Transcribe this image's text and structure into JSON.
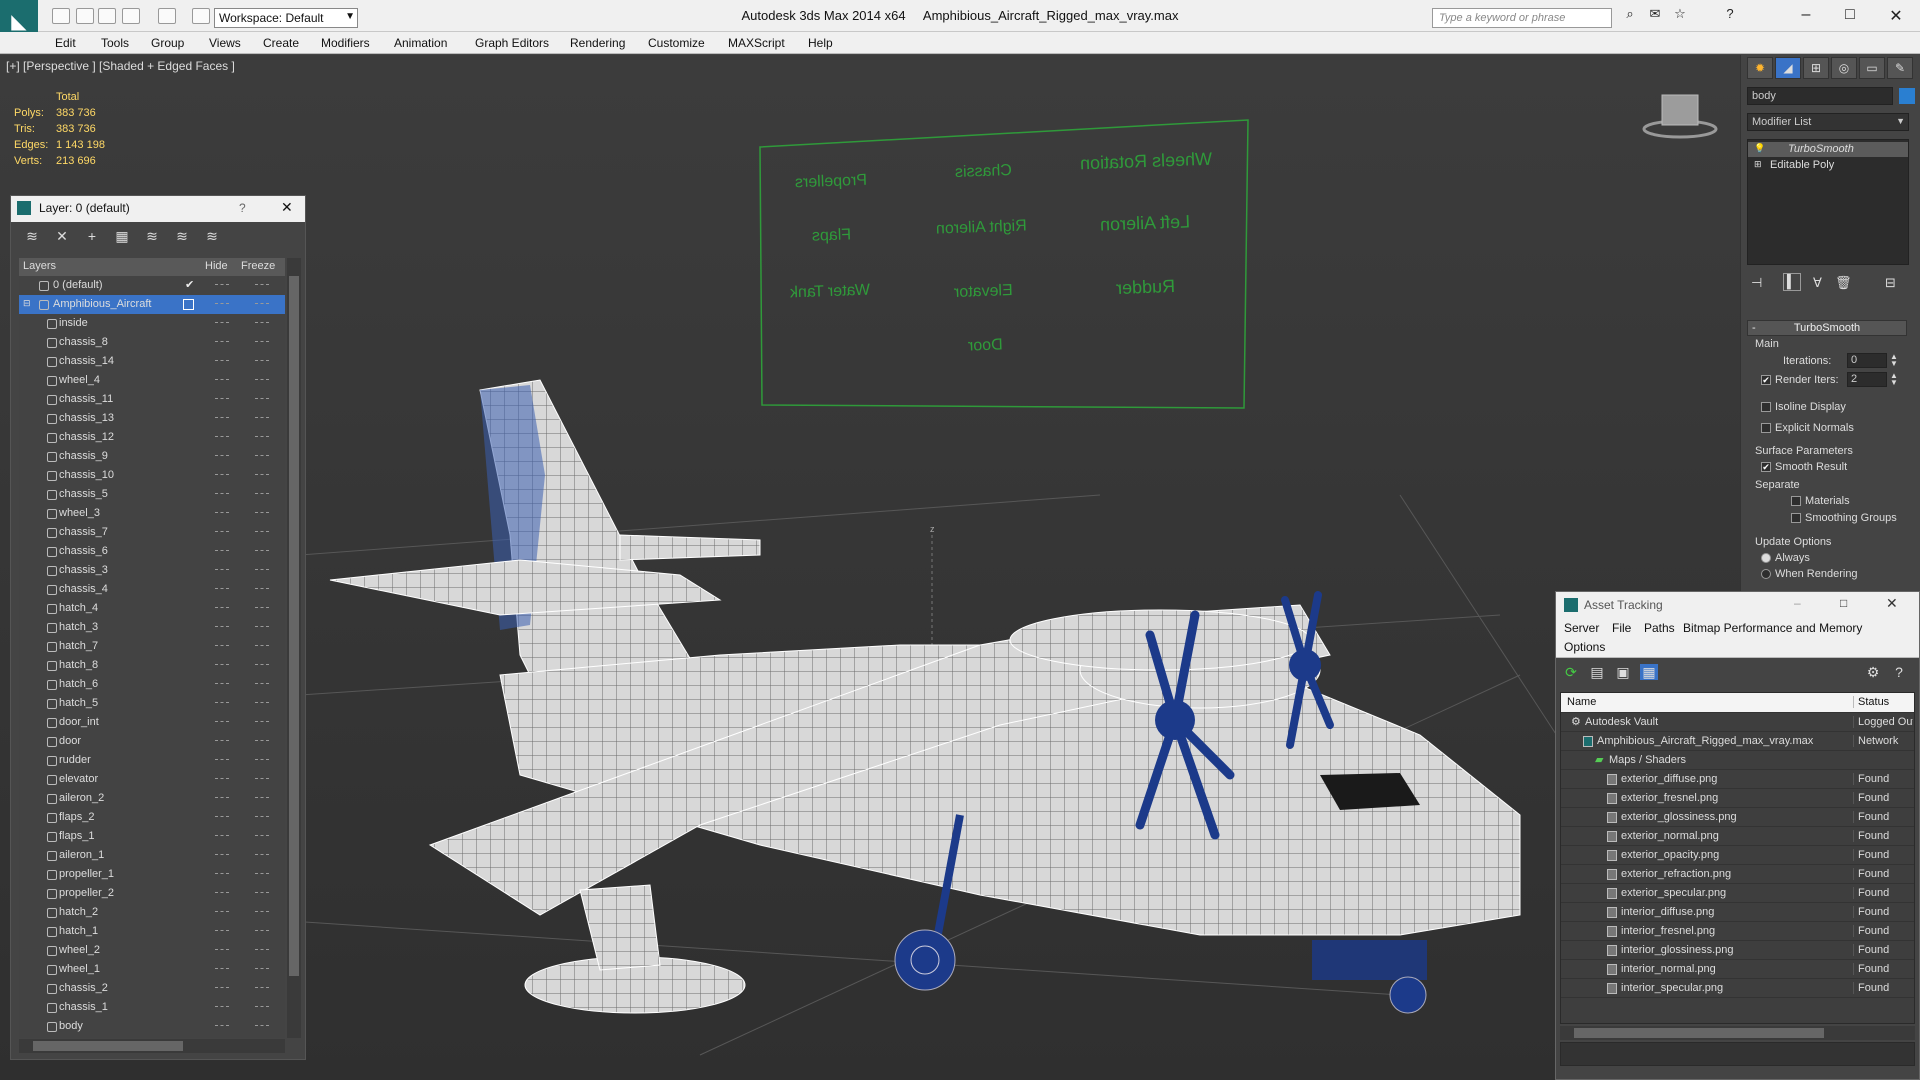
{
  "titlebar": {
    "app": "Autodesk 3ds Max  2014 x64",
    "file": "Amphibious_Aircraft_Rigged_max_vray.max",
    "workspace": "Workspace: Default",
    "search_placeholder": "Type a keyword or phrase"
  },
  "menu": [
    "Edit",
    "Tools",
    "Group",
    "Views",
    "Create",
    "Modifiers",
    "Animation",
    "Graph Editors",
    "Rendering",
    "Customize",
    "MAXScript",
    "Help"
  ],
  "viewport": {
    "label": "[+] [Perspective ] [Shaded + Edged Faces ]",
    "stats": {
      "header": "Total",
      "rows": [
        {
          "label": "Polys:",
          "value": "383 736"
        },
        {
          "label": "Tris:",
          "value": "383 736"
        },
        {
          "label": "Edges:",
          "value": "1 143 198"
        },
        {
          "label": "Verts:",
          "value": "213 696"
        }
      ]
    },
    "rig_panel": {
      "labels": [
        "Propellers",
        "Chassis",
        "Wheels Rotation",
        "Flaps",
        "Right Aileron",
        "Left Aileron",
        "Water Tank",
        "Elevator",
        "Rudder",
        "Door"
      ]
    },
    "axis_label": "z"
  },
  "layers": {
    "title": "Layer: 0 (default)",
    "help": "?",
    "columns": {
      "name": "Layers",
      "hide": "Hide",
      "freeze": "Freeze"
    },
    "root_layers": [
      {
        "name": "0 (default)"
      },
      {
        "name": "Amphibious_Aircraft"
      }
    ],
    "objects": [
      "inside",
      "chassis_8",
      "chassis_14",
      "wheel_4",
      "chassis_11",
      "chassis_13",
      "chassis_12",
      "chassis_9",
      "chassis_10",
      "chassis_5",
      "wheel_3",
      "chassis_7",
      "chassis_6",
      "chassis_3",
      "chassis_4",
      "hatch_4",
      "hatch_3",
      "hatch_7",
      "hatch_8",
      "hatch_6",
      "hatch_5",
      "door_int",
      "door",
      "rudder",
      "elevator",
      "aileron_2",
      "flaps_2",
      "flaps_1",
      "aileron_1",
      "propeller_1",
      "propeller_2",
      "hatch_2",
      "hatch_1",
      "wheel_2",
      "wheel_1",
      "chassis_2",
      "chassis_1",
      "body"
    ]
  },
  "command_panel": {
    "object_name": "body",
    "modifier_list": "Modifier List",
    "stack": [
      "TurboSmooth",
      "Editable Poly"
    ],
    "rollout_title": "TurboSmooth",
    "main": "Main",
    "iterations_label": "Iterations:",
    "iterations_value": "0",
    "render_iters_label": "Render Iters:",
    "render_iters_value": "2",
    "isoline": "Isoline Display",
    "explicit_normals": "Explicit Normals",
    "surface_params": "Surface Parameters",
    "smooth_result": "Smooth Result",
    "separate": "Separate",
    "materials": "Materials",
    "smoothing_groups": "Smoothing Groups",
    "update_options": "Update Options",
    "always": "Always",
    "when_rendering": "When Rendering"
  },
  "asset_tracking": {
    "title": "Asset Tracking",
    "menu": [
      "Server",
      "File",
      "Paths",
      "Bitmap Performance and Memory",
      "Options"
    ],
    "columns": {
      "name": "Name",
      "status": "Status"
    },
    "rows": [
      {
        "name": "Autodesk Vault",
        "status": "Logged Out"
      },
      {
        "name": "Amphibious_Aircraft_Rigged_max_vray.max",
        "status": "Network"
      },
      {
        "name": "Maps / Shaders",
        "status": ""
      },
      {
        "name": "exterior_diffuse.png",
        "status": "Found"
      },
      {
        "name": "exterior_fresnel.png",
        "status": "Found"
      },
      {
        "name": "exterior_glossiness.png",
        "status": "Found"
      },
      {
        "name": "exterior_normal.png",
        "status": "Found"
      },
      {
        "name": "exterior_opacity.png",
        "status": "Found"
      },
      {
        "name": "exterior_refraction.png",
        "status": "Found"
      },
      {
        "name": "exterior_specular.png",
        "status": "Found"
      },
      {
        "name": "interior_diffuse.png",
        "status": "Found"
      },
      {
        "name": "interior_fresnel.png",
        "status": "Found"
      },
      {
        "name": "interior_glossiness.png",
        "status": "Found"
      },
      {
        "name": "interior_normal.png",
        "status": "Found"
      },
      {
        "name": "interior_specular.png",
        "status": "Found"
      }
    ]
  },
  "colors": {
    "accent": "#1b6d6e",
    "selection": "#3a73c7",
    "wire": "#ffffff",
    "rig": "#2f9a3a"
  }
}
